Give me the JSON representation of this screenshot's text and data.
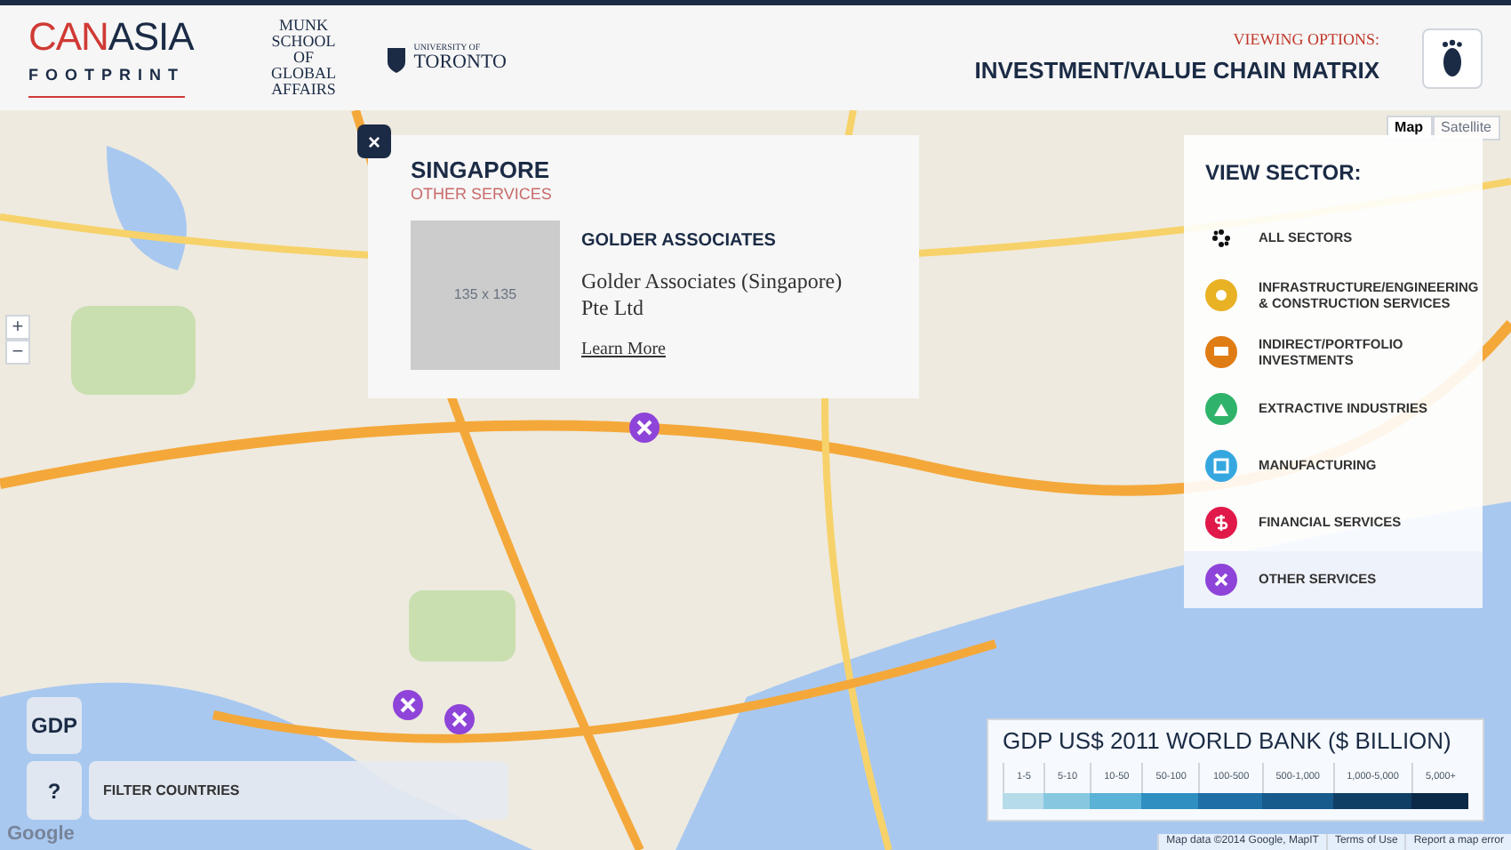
{
  "header": {
    "logo_top_left": "CAN",
    "logo_top_right": "ASIA",
    "logo_bottom": "FOOTPRINT",
    "munk": "MUNK SCHOOL OF GLOBAL AFFAIRS",
    "uoft_small": "UNIVERSITY OF",
    "uoft": "TORONTO",
    "viewing_label": "VIEWING OPTIONS:",
    "viewing_value": "INVESTMENT/VALUE CHAIN MATRIX"
  },
  "map": {
    "kind": "picture",
    "type_buttons": [
      {
        "label": "Map",
        "selected": true
      },
      {
        "label": "Satellite",
        "selected": false
      }
    ],
    "zoom": [
      "+",
      "−"
    ],
    "markers": [
      {
        "color": "#8e44d8"
      },
      {
        "color": "#8e44d8"
      },
      {
        "color": "#8e44d8"
      }
    ],
    "attribution": [
      "Map data ©2014 Google, MapIT",
      "Terms of Use",
      "Report a map error"
    ],
    "google": "Google"
  },
  "popup": {
    "close": "×",
    "country": "SINGAPORE",
    "sector": "OTHER SERVICES",
    "image_placeholder": "135 x 135",
    "company": "GOLDER ASSOCIATES",
    "detail": "Golder Associates (Singapore) Pte Ltd",
    "link": "Learn More"
  },
  "sector_panel": {
    "title": "VIEW SECTOR:",
    "items": [
      {
        "label": "ALL SECTORS",
        "kind": "all",
        "color": "#111111",
        "selected": false
      },
      {
        "label": "INFRASTRUCTURE/ENGINEERING & CONSTRUCTION SERVICES",
        "kind": "gear",
        "color": "#e8b224",
        "selected": false
      },
      {
        "label": "INDIRECT/PORTFOLIO INVESTMENTS",
        "kind": "sign",
        "color": "#e07c14",
        "selected": false
      },
      {
        "label": "EXTRACTIVE INDUSTRIES",
        "kind": "mine",
        "color": "#2fb36a",
        "selected": false
      },
      {
        "label": "MANUFACTURING",
        "kind": "box",
        "color": "#35a7e0",
        "selected": false
      },
      {
        "label": "FINANCIAL SERVICES",
        "kind": "dollar",
        "color": "#e0194a",
        "selected": false
      },
      {
        "label": "OTHER SERVICES",
        "kind": "tools",
        "color": "#8e44d8",
        "selected": true
      }
    ]
  },
  "legend": {
    "title": "GDP US$ 2011 WORLD BANK ($ BILLION)",
    "bins": [
      {
        "label": "1-5",
        "color": "#b6dbe9"
      },
      {
        "label": "5-10",
        "color": "#87c8e0"
      },
      {
        "label": "10-50",
        "color": "#5ab2d6"
      },
      {
        "label": "50-100",
        "color": "#2f8fc0"
      },
      {
        "label": "100-500",
        "color": "#1f6fa6"
      },
      {
        "label": "500-1,000",
        "color": "#175a8c"
      },
      {
        "label": "1,000-5,000",
        "color": "#103f66"
      },
      {
        "label": "5,000+",
        "color": "#0b2a48"
      }
    ]
  },
  "controls": {
    "gdp": "GDP",
    "help": "?",
    "filter": "FILTER COUNTRIES"
  }
}
